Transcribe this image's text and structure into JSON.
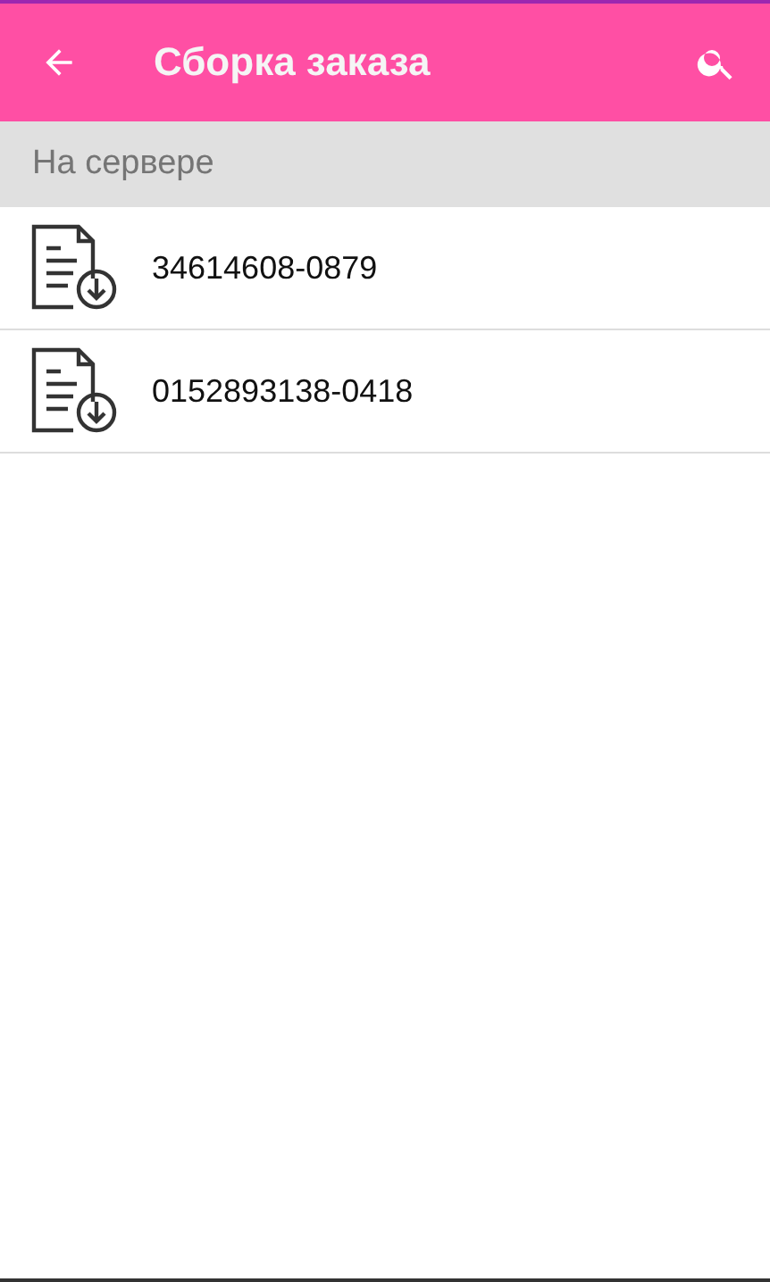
{
  "toolbar": {
    "title": "Сборка заказа"
  },
  "section": {
    "title": "На сервере"
  },
  "orders": [
    {
      "number": "34614608-0879"
    },
    {
      "number": "0152893138-0418"
    }
  ]
}
